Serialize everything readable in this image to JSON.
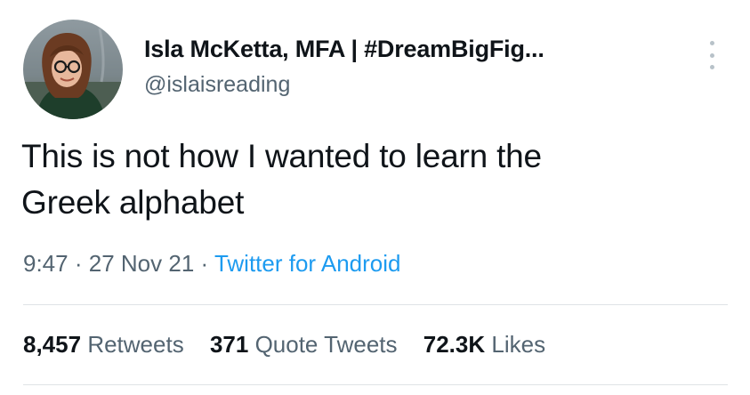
{
  "author": {
    "display_name": "Isla McKetta, MFA | #DreamBigFig...",
    "handle": "@islaisreading"
  },
  "tweet": {
    "text_line1": "This is not how I wanted to learn the",
    "text_line2": "Greek alphabet"
  },
  "meta": {
    "time": "9:47",
    "separator1": "·",
    "date": "27 Nov 21",
    "separator2": "·",
    "source": "Twitter for Android"
  },
  "stats": {
    "retweets": {
      "count": "8,457",
      "label": "Retweets"
    },
    "quote_tweets": {
      "count": "371",
      "label": "Quote Tweets"
    },
    "likes": {
      "count": "72.3K",
      "label": "Likes"
    }
  },
  "icons": {
    "avatar": "profile-photo",
    "more": "more-options-icon"
  }
}
